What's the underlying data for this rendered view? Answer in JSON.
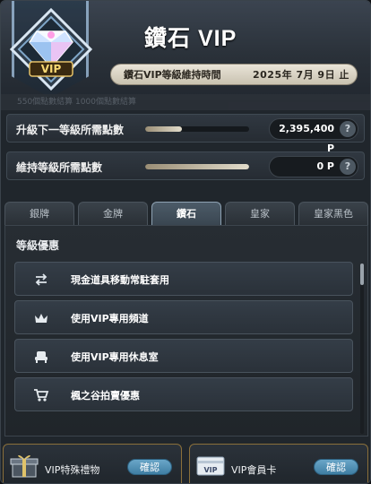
{
  "header": {
    "title": "鑽石 VIP",
    "expiry_label": "鑽石VIP等級維持時間",
    "expiry_date": "2025年  7月  9日  止",
    "badge_text": "VIP",
    "decor_text": "550個點數結算   1000個點數結算"
  },
  "points": {
    "upgrade": {
      "label": "升級下一等級所需點數",
      "value": "2,395,400 P",
      "progress": 0.35
    },
    "maintain": {
      "label": "維持等級所需點數",
      "value": "0 P",
      "progress": 1.0
    },
    "help_icon": "?"
  },
  "tabs": [
    {
      "label": "銀牌"
    },
    {
      "label": "金牌"
    },
    {
      "label": "鑽石"
    },
    {
      "label": "皇家"
    },
    {
      "label": "皇家黑色"
    }
  ],
  "active_tab": "鑽石",
  "benefits": {
    "title": "等級優惠",
    "items": [
      {
        "label": "現金道具移動常駐套用",
        "icon": "swap-icon"
      },
      {
        "label": "使用VIP專用頻道",
        "icon": "crown-icon"
      },
      {
        "label": "使用VIP專用休息室",
        "icon": "lounge-chair-icon"
      },
      {
        "label": "楓之谷拍賣優惠",
        "icon": "cart-icon"
      }
    ]
  },
  "footer": {
    "gift": {
      "label": "VIP特殊禮物",
      "button": "確認"
    },
    "card": {
      "label": "VIP會員卡",
      "button": "確認",
      "card_text": "VIP"
    }
  },
  "colors": {
    "accent_button": "#4f90b6",
    "active_tab": "#4c5b68",
    "progress": "#e2dccb"
  }
}
